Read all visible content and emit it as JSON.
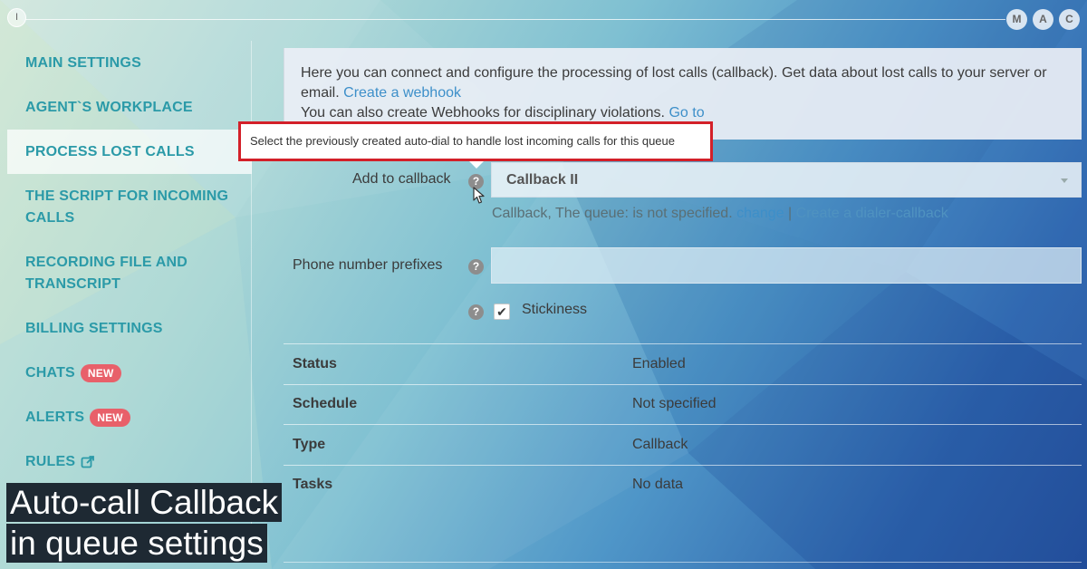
{
  "window": {
    "left_badge": "I",
    "right_badges": [
      "M",
      "A",
      "C"
    ]
  },
  "sidebar": {
    "items": [
      {
        "label": "MAIN SETTINGS"
      },
      {
        "label": "AGENT`S WORKPLACE"
      },
      {
        "label": "PROCESS LOST CALLS",
        "active": true
      },
      {
        "label": "THE SCRIPT FOR INCOMING CALLS"
      },
      {
        "label": "RECORDING FILE AND TRANSCRIPT"
      },
      {
        "label": "BILLING SETTINGS"
      },
      {
        "label": "CHATS",
        "badge": "NEW"
      },
      {
        "label": "ALERTS",
        "badge": "NEW"
      },
      {
        "label": "RULES",
        "icon": "external-link-icon"
      }
    ]
  },
  "info": {
    "text1": "Here you can connect and configure the processing of lost calls (callback). Get data about lost calls to your server or email.",
    "link1": "Create a webhook",
    "text2": "You can also create Webhooks for disciplinary violations.",
    "link2": "Go to"
  },
  "tooltip": {
    "text": "Select the previously created auto-dial to handle lost incoming calls for this queue"
  },
  "form": {
    "callback_label": "Add to callback",
    "callback_value": "Callback II",
    "hint_text": "Callback, The queue: is not specified.",
    "hint_change": "change",
    "hint_separator": "|",
    "hint_create": "Create a dialer-callback",
    "prefix_label": "Phone number prefixes",
    "prefix_value": "",
    "help_glyph": "?",
    "stickiness_label": "Stickiness",
    "stickiness_checked": true,
    "check_glyph": "✔"
  },
  "details": {
    "rows": [
      {
        "key": "Status",
        "value": "Enabled"
      },
      {
        "key": "Schedule",
        "value": "Not specified"
      },
      {
        "key": "Type",
        "value": "Callback"
      },
      {
        "key": "Tasks",
        "value": "No data"
      }
    ]
  },
  "caption": {
    "line1": "Auto-call Callback",
    "line2": "in queue settings"
  },
  "colors": {
    "accent": "#2b9aa8",
    "link": "#3d8fc9",
    "badge": "#e8606a",
    "tooltip_border": "#d32029"
  }
}
